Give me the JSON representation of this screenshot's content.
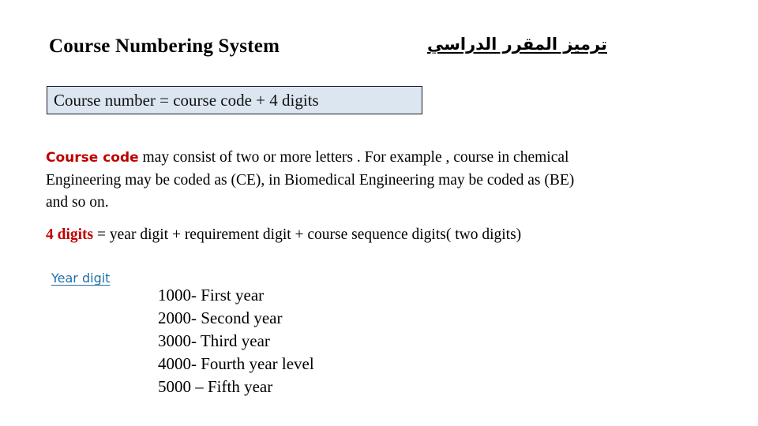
{
  "slide": {
    "background_color": "#ffffff",
    "title_en": "Course Numbering System",
    "title_ar": "ترميز المقرر الدراسي",
    "definition_box": {
      "text": "Course number = course code + 4 digits",
      "fill_color": "#dce6f1",
      "border_color": "#1c1c28"
    },
    "body": {
      "keyword_course_code": "Course code",
      "line1_rest": " may consist of two or more letters . For example , course in chemical",
      "line2": "Engineering may be coded as (CE), in Biomedical Engineering  may be coded as (BE)",
      "line3": "and so on.",
      "keyword_four_digits": "4 digits",
      "line4_rest": " =  year digit + requirement digit + course sequence digits( two digits)",
      "keyword_color": "#c00000"
    },
    "year_digit_link": {
      "label": "Year digit",
      "color": "#1f6fa8"
    },
    "year_list": [
      "1000- First year",
      "2000- Second year",
      "3000- Third year",
      "4000- Fourth year level",
      "5000 – Fifth year"
    ]
  }
}
